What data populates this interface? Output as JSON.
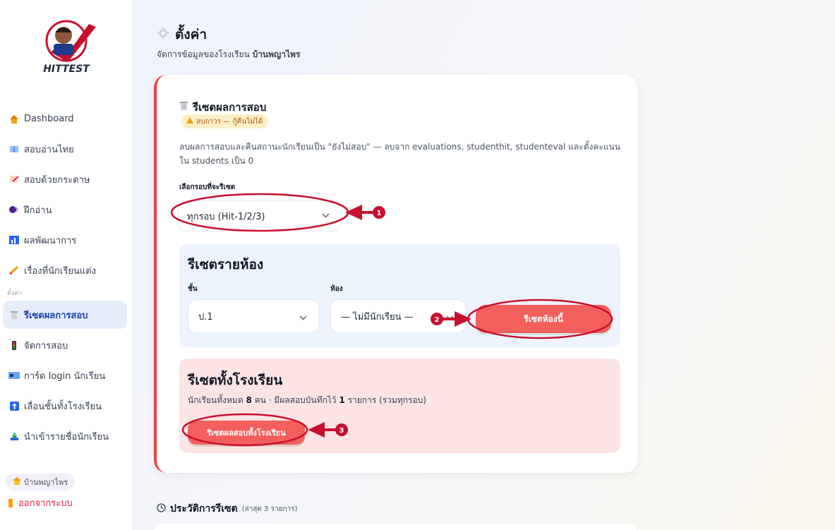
{
  "sidebar": {
    "logo_text": "HITTEST",
    "items": [
      {
        "label": "Dashboard",
        "icon": "home-icon"
      },
      {
        "label": "สอบอ่านไทย",
        "icon": "book-icon"
      },
      {
        "label": "สอบด้วยกระดาษ",
        "icon": "paper-icon"
      },
      {
        "label": "ฝึกอ่าน",
        "icon": "speak-icon"
      },
      {
        "label": "ผลพัฒนาการ",
        "icon": "chart-icon"
      },
      {
        "label": "เรื่องที่นักเรียนแต่ง",
        "icon": "pen-icon"
      }
    ],
    "section_label": "ตั้งค่า",
    "settings_items": [
      {
        "label": "รีเซตผลการสอบ",
        "icon": "trash-icon"
      },
      {
        "label": "จัดการสอบ",
        "icon": "traffic-icon"
      },
      {
        "label": "การ์ด login นักเรียน",
        "icon": "id-card-icon"
      },
      {
        "label": "เลื่อนชั้นทั้งโรงเรียน",
        "icon": "up-arrow-icon"
      },
      {
        "label": "นำเข้ารายชื่อนักเรียน",
        "icon": "import-icon"
      }
    ],
    "school_name": "บ้านพญาไพร",
    "logout": "ออกจากระบบ"
  },
  "header": {
    "title": "ตั้งค่า",
    "subtitle_prefix": "จัดการข้อมูลของโรงเรียน",
    "subtitle_school": "บ้านพญาไพร"
  },
  "reset_card": {
    "title": "รีเซตผลการสอบ",
    "warning": "ลบถาวร — กู้คืนไม่ได้",
    "description": "ลบผลการสอบและคืนสถานะนักเรียนเป็น \"ยังไม่สอบ\" — ลบจาก evaluations, studenthit, studenteval และตั้งคะแนนใน students เป็น 0",
    "round_label": "เลือกรอบที่จะรีเซต",
    "round_value": "ทุกรอบ (Hit-1/2/3)",
    "room_section": {
      "title": "รีเซตรายห้อง",
      "grade_label": "ชั้น",
      "grade_value": "ป.1",
      "room_label": "ห้อง",
      "room_value": "— ไม่มีนักเรียน —",
      "button": "รีเซตห้องนี้"
    },
    "school_section": {
      "title": "รีเซตทั้งโรงเรียน",
      "desc_a": "นักเรียนทั้งหมด",
      "student_count": "8",
      "desc_b": "คน · มีผลสอบบันทึกไว้",
      "record_count": "1",
      "desc_c": "รายการ (รวมทุกรอบ)",
      "button": "รีเซตผลสอบทั้งโรงเรียน"
    }
  },
  "history": {
    "title": "ประวัติการรีเซต",
    "note": "(ล่าสุด 3 รายการ)"
  },
  "annotations": [
    "1",
    "2",
    "3"
  ],
  "colors": {
    "accent_red": "#f25f5c",
    "annotation": "#c8102e",
    "active_nav": "#e6edfb"
  }
}
